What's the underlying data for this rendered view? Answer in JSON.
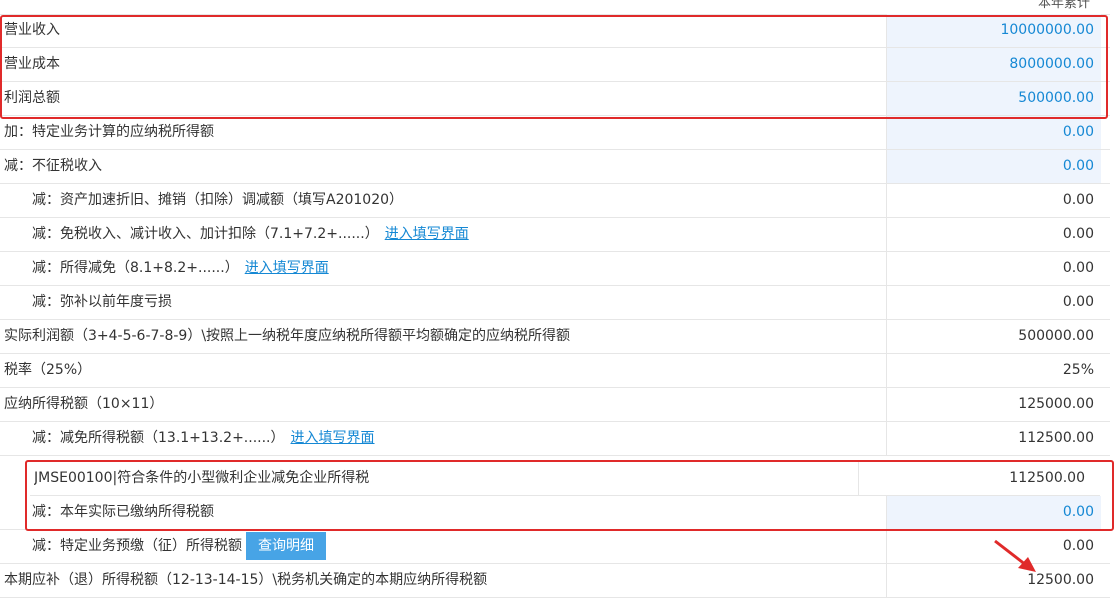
{
  "header": {
    "column_title": "本年累计"
  },
  "rows": [
    {
      "label": "营业收入",
      "value": "10000000.00"
    },
    {
      "label": "营业成本",
      "value": "8000000.00"
    },
    {
      "label": "利润总额",
      "value": "500000.00"
    },
    {
      "label": "加：特定业务计算的应纳税所得额",
      "value": "0.00"
    },
    {
      "label": "减：不征税收入",
      "value": "0.00"
    },
    {
      "label": "减：资产加速折旧、摊销（扣除）调减额（填写A201020）",
      "value": "0.00"
    },
    {
      "label": "减：免税收入、减计收入、加计扣除（7.1+7.2+......）",
      "link": "进入填写界面",
      "value": "0.00"
    },
    {
      "label": "减：所得减免（8.1+8.2+......）",
      "link": "进入填写界面",
      "value": "0.00"
    },
    {
      "label": "减：弥补以前年度亏损",
      "value": "0.00"
    },
    {
      "label": "实际利润额（3+4-5-6-7-8-9）\\按照上一纳税年度应纳税所得额平均额确定的应纳税所得额",
      "value": "500000.00"
    },
    {
      "label": "税率（25%）",
      "value": "25%"
    },
    {
      "label": "应纳所得税额（10×11）",
      "value": "125000.00"
    },
    {
      "label": "减：减免所得税额（13.1+13.2+......）",
      "link": "进入填写界面",
      "value": "112500.00"
    },
    {
      "label": "JMSE00100|符合条件的小型微利企业减免企业所得税",
      "value": "112500.00"
    },
    {
      "label": "减：本年实际已缴纳所得税额",
      "value": "0.00"
    },
    {
      "label": "减：特定业务预缴（征）所得税额",
      "button": "查询明细",
      "value": "0.00"
    },
    {
      "label": "本期应补（退）所得税额（12-13-14-15）\\税务机关确定的本期应纳所得税额",
      "value": "12500.00"
    }
  ],
  "colors": {
    "highlight_border": "#e02a2a",
    "link": "#1588d4",
    "editable_bg": "#eef4fd",
    "button_bg": "#47a4e6"
  }
}
